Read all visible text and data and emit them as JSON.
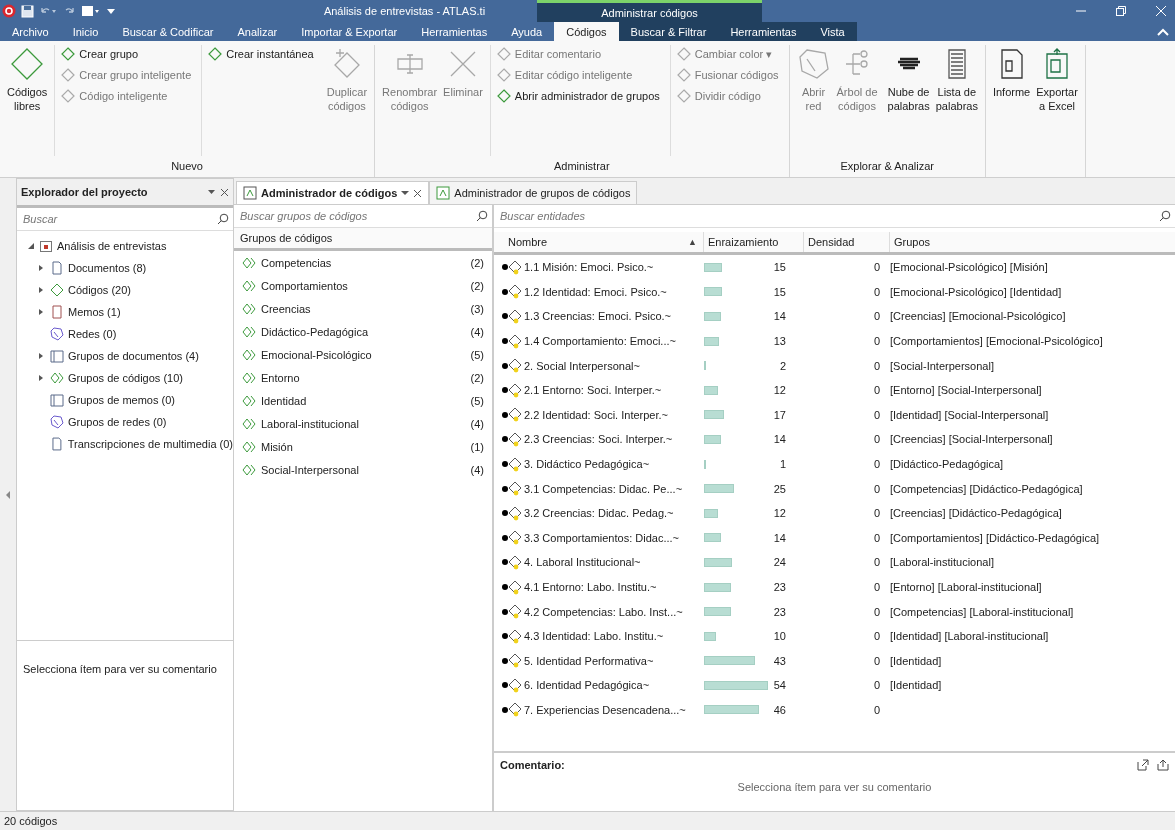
{
  "window": {
    "title": "Análisis de entrevistas - ATLAS.ti",
    "context_title": "Administrar códigos"
  },
  "menu_tabs": [
    {
      "label": "Archivo",
      "selected": false,
      "contextual": false
    },
    {
      "label": "Inicio",
      "selected": false,
      "contextual": false
    },
    {
      "label": "Buscar & Codificar",
      "selected": false,
      "contextual": false
    },
    {
      "label": "Analizar",
      "selected": false,
      "contextual": false
    },
    {
      "label": "Importar & Exportar",
      "selected": false,
      "contextual": false
    },
    {
      "label": "Herramientas",
      "selected": false,
      "contextual": false
    },
    {
      "label": "Ayuda",
      "selected": false,
      "contextual": false
    },
    {
      "label": "Códigos",
      "selected": true,
      "contextual": true
    },
    {
      "label": "Buscar & Filtrar",
      "selected": false,
      "contextual": true
    },
    {
      "label": "Herramientas",
      "selected": false,
      "contextual": true
    },
    {
      "label": "Vista",
      "selected": false,
      "contextual": true
    }
  ],
  "ribbon": {
    "groups": [
      {
        "label": "Nuevo",
        "columns": [
          {
            "kind": "large",
            "items": [
              {
                "label": "Códigos\nlibres",
                "disabled": false
              }
            ]
          },
          {
            "kind": "stack",
            "items": [
              {
                "label": "Crear grupo",
                "disabled": false
              },
              {
                "label": "Crear grupo inteligente",
                "disabled": true
              },
              {
                "label": "Código inteligente",
                "disabled": true
              }
            ]
          },
          {
            "kind": "stack",
            "items": [
              {
                "label": "Crear instantánea",
                "disabled": false
              }
            ]
          },
          {
            "kind": "large",
            "items": [
              {
                "label": "Duplicar\ncódigos",
                "disabled": true
              }
            ]
          }
        ]
      },
      {
        "label": "Administrar",
        "columns": [
          {
            "kind": "large",
            "items": [
              {
                "label": "Renombrar\ncódigos",
                "disabled": true
              },
              {
                "label": "Eliminar",
                "disabled": true
              }
            ]
          },
          {
            "kind": "stack",
            "items": [
              {
                "label": "Editar comentario",
                "disabled": true
              },
              {
                "label": "Editar código inteligente",
                "disabled": true
              },
              {
                "label": "Abrir administrador de grupos",
                "disabled": false
              }
            ]
          },
          {
            "kind": "stack",
            "items": [
              {
                "label": "Cambiar color ▾",
                "disabled": true
              },
              {
                "label": "Fusionar códigos",
                "disabled": true
              },
              {
                "label": "Dividir código",
                "disabled": true
              }
            ]
          }
        ]
      },
      {
        "label": "Explorar & Analizar",
        "columns": [
          {
            "kind": "large",
            "items": [
              {
                "label": "Abrir\nred",
                "disabled": true
              },
              {
                "label": "Árbol de\ncódigos",
                "disabled": true
              }
            ]
          },
          {
            "kind": "large",
            "items": [
              {
                "label": "Nube de\npalabras",
                "disabled": false
              },
              {
                "label": "Lista de\npalabras",
                "disabled": false
              }
            ]
          }
        ]
      },
      {
        "columns": [
          {
            "kind": "large",
            "items": [
              {
                "label": "Informe",
                "disabled": false
              },
              {
                "label": "Exportar\na Excel",
                "disabled": false
              }
            ]
          }
        ]
      }
    ]
  },
  "explorer": {
    "title": "Explorador del proyecto",
    "search": {
      "placeholder": "Buscar"
    },
    "tree": {
      "label": "Análisis de entrevistas",
      "expanded": true,
      "children": [
        {
          "label": "Documentos (8)",
          "expandable": true
        },
        {
          "label": "Códigos (20)",
          "expandable": true
        },
        {
          "label": "Memos (1)",
          "expandable": true
        },
        {
          "label": "Redes (0)",
          "expandable": false
        },
        {
          "label": "Grupos de documentos (4)",
          "expandable": true
        },
        {
          "label": "Grupos de códigos (10)",
          "expandable": true
        },
        {
          "label": "Grupos de memos (0)",
          "expandable": false
        },
        {
          "label": "Grupos de redes (0)",
          "expandable": false
        },
        {
          "label": "Transcripciones de multimedia (0)",
          "expandable": false
        }
      ]
    },
    "comment_placeholder": "Selecciona ítem para ver su comentario"
  },
  "doc_tabs": [
    {
      "label": "Administrador de códigos",
      "selected": true
    },
    {
      "label": "Administrador de grupos de códigos",
      "selected": false
    }
  ],
  "code_groups": {
    "search": {
      "placeholder": "Buscar grupos de códigos"
    },
    "header": "Grupos de códigos",
    "rows": [
      {
        "name": "Competencias",
        "count": "(2)"
      },
      {
        "name": "Comportamientos",
        "count": "(2)"
      },
      {
        "name": "Creencias",
        "count": "(3)"
      },
      {
        "name": "Didáctico-Pedagógica",
        "count": "(4)"
      },
      {
        "name": "Emocional-Psicológico",
        "count": "(5)"
      },
      {
        "name": "Entorno",
        "count": "(2)"
      },
      {
        "name": "Identidad",
        "count": "(5)"
      },
      {
        "name": "Laboral-institucional",
        "count": "(4)"
      },
      {
        "name": "Misión",
        "count": "(1)"
      },
      {
        "name": "Social-Interpersonal",
        "count": "(4)"
      }
    ]
  },
  "entities": {
    "search": {
      "placeholder": "Buscar entidades"
    },
    "columns": [
      {
        "label": "Nombre",
        "sorted": true
      },
      {
        "label": "Enraizamiento",
        "sorted": false
      },
      {
        "label": "Densidad",
        "sorted": false
      },
      {
        "label": "Grupos",
        "sorted": false
      }
    ],
    "sort_indicator": "▲",
    "rows": [
      {
        "name": "1.1 Misión: Emoci. Psico.~",
        "grounding": "15",
        "density": "0",
        "groups": "[Emocional-Psicológico] [Misión]"
      },
      {
        "name": "1.2 Identidad: Emoci. Psico.~",
        "grounding": "15",
        "density": "0",
        "groups": "[Emocional-Psicológico] [Identidad]"
      },
      {
        "name": "1.3 Creencias: Emoci. Psico.~",
        "grounding": "14",
        "density": "0",
        "groups": "[Creencias] [Emocional-Psicológico]"
      },
      {
        "name": "1.4 Comportamiento: Emoci...~",
        "grounding": "13",
        "density": "0",
        "groups": "[Comportamientos] [Emocional-Psicológico]"
      },
      {
        "name": "2. Social Interpersonal~",
        "grounding": "2",
        "density": "0",
        "groups": "[Social-Interpersonal]"
      },
      {
        "name": "2.1 Entorno: Soci. Interper.~",
        "grounding": "12",
        "density": "0",
        "groups": "[Entorno] [Social-Interpersonal]"
      },
      {
        "name": "2.2 Identidad: Soci. Interper.~",
        "grounding": "17",
        "density": "0",
        "groups": "[Identidad] [Social-Interpersonal]"
      },
      {
        "name": "2.3 Creencias: Soci. Interper.~",
        "grounding": "14",
        "density": "0",
        "groups": "[Creencias] [Social-Interpersonal]"
      },
      {
        "name": "3. Didáctico Pedagógica~",
        "grounding": "1",
        "density": "0",
        "groups": "[Didáctico-Pedagógica]"
      },
      {
        "name": "3.1 Competencias: Didac. Pe...~",
        "grounding": "25",
        "density": "0",
        "groups": "[Competencias] [Didáctico-Pedagógica]"
      },
      {
        "name": "3.2 Creencias: Didac. Pedag.~",
        "grounding": "12",
        "density": "0",
        "groups": "[Creencias] [Didáctico-Pedagógica]"
      },
      {
        "name": "3.3 Comportamientos: Didac...~",
        "grounding": "14",
        "density": "0",
        "groups": "[Comportamientos] [Didáctico-Pedagógica]"
      },
      {
        "name": "4. Laboral Institucional~",
        "grounding": "24",
        "density": "0",
        "groups": "[Laboral-institucional]"
      },
      {
        "name": "4.1 Entorno: Labo. Institu.~",
        "grounding": "23",
        "density": "0",
        "groups": "[Entorno] [Laboral-institucional]"
      },
      {
        "name": "4.2 Competencias: Labo. Inst...~",
        "grounding": "23",
        "density": "0",
        "groups": "[Competencias] [Laboral-institucional]"
      },
      {
        "name": "4.3 Identidad: Labo. Institu.~",
        "grounding": "10",
        "density": "0",
        "groups": "[Identidad] [Laboral-institucional]"
      },
      {
        "name": "5. Identidad Performativa~",
        "grounding": "43",
        "density": "0",
        "groups": "[Identidad]"
      },
      {
        "name": "6. Identidad Pedagógica~",
        "grounding": "54",
        "density": "0",
        "groups": "[Identidad]"
      },
      {
        "name": "7. Experiencias Desencadena...~",
        "grounding": "46",
        "density": "0"
      }
    ]
  },
  "comment": {
    "label": "Comentario:",
    "placeholder": "Selecciona ítem para ver su comentario"
  },
  "status_bar": "20 códigos"
}
